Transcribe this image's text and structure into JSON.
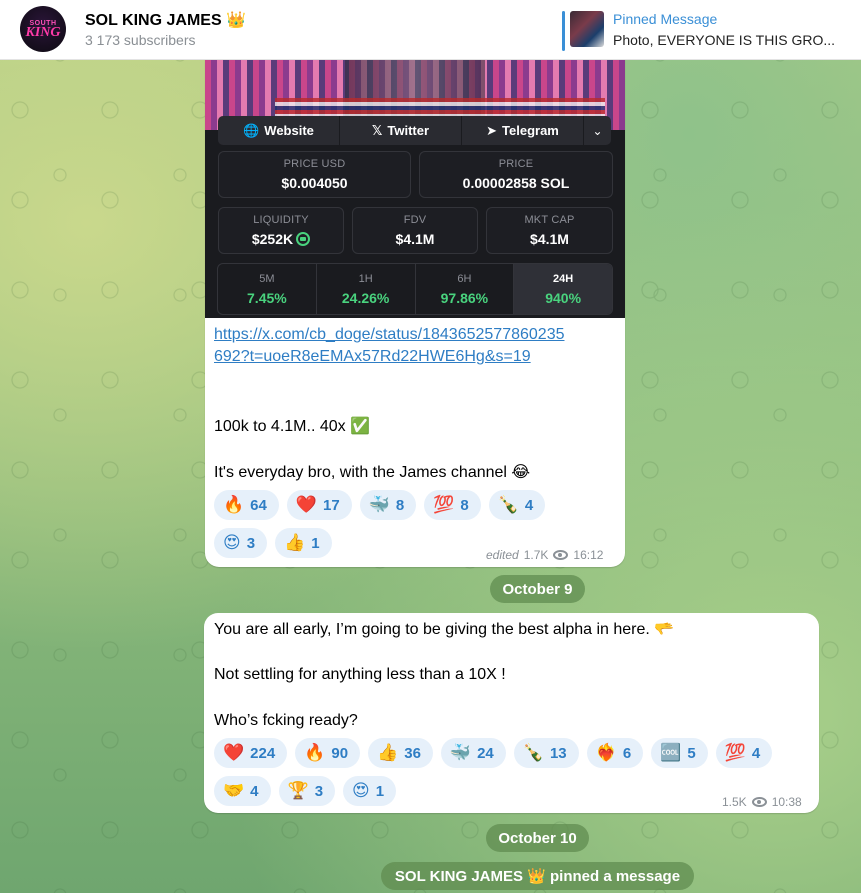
{
  "header": {
    "channel_title": "SOL KING JAMES 👑",
    "subscribers": "3 173 subscribers",
    "avatar_top": "SOUTH",
    "avatar_main": "KING",
    "pinned_title": "Pinned Message",
    "pinned_text": "Photo, EVERYONE IS THIS GRO..."
  },
  "message1": {
    "preview_links": {
      "website": "Website",
      "twitter": "Twitter",
      "telegram": "Telegram"
    },
    "stats": {
      "price_usd_label": "PRICE USD",
      "price_usd_value": "$0.004050",
      "price_label": "PRICE",
      "price_value": "0.00002858 SOL",
      "liquidity_label": "LIQUIDITY",
      "liquidity_value": "$252K",
      "fdv_label": "FDV",
      "fdv_value": "$4.1M",
      "mktcap_label": "MKT CAP",
      "mktcap_value": "$4.1M"
    },
    "timeframes": [
      {
        "label": "5M",
        "value": "7.45%"
      },
      {
        "label": "1H",
        "value": "24.26%"
      },
      {
        "label": "6H",
        "value": "97.86%"
      },
      {
        "label": "24H",
        "value": "940%"
      }
    ],
    "link_line1": "https://x.com/cb_doge/status/1843652577860235",
    "link_line2": "692?t=uoeR8eEMAx57Rd22HWE6Hg&s=19",
    "text_line1": "100k to 4.1M.. 40x ✅",
    "text_line2": "It's everyday bro, with the James channel 😂",
    "reactions": [
      {
        "emoji": "🔥",
        "count": "64"
      },
      {
        "emoji": "❤️",
        "count": "17"
      },
      {
        "emoji": "🐳",
        "count": "8"
      },
      {
        "emoji": "💯",
        "count": "8"
      },
      {
        "emoji": "🍾",
        "count": "4"
      },
      {
        "emoji": "😍",
        "count": "3"
      },
      {
        "emoji": "👍",
        "count": "1"
      }
    ],
    "edited": "edited",
    "views": "1.7K",
    "time": "16:12"
  },
  "date1": "October 9",
  "message2": {
    "line1": "You are all early, I’m going to be giving the best alpha in here. 🫳",
    "line2": "Not settling for anything less than a 10X !",
    "line3": "Who’s fcking ready?",
    "reactions": [
      {
        "emoji": "❤️",
        "count": "224"
      },
      {
        "emoji": "🔥",
        "count": "90"
      },
      {
        "emoji": "👍",
        "count": "36"
      },
      {
        "emoji": "🐳",
        "count": "24"
      },
      {
        "emoji": "🍾",
        "count": "13"
      },
      {
        "emoji": "❤️‍🔥",
        "count": "6"
      },
      {
        "emoji": "🆒",
        "count": "5"
      },
      {
        "emoji": "💯",
        "count": "4"
      },
      {
        "emoji": "🤝",
        "count": "4"
      },
      {
        "emoji": "🏆",
        "count": "3"
      },
      {
        "emoji": "😍",
        "count": "1"
      }
    ],
    "views": "1.5K",
    "time": "10:38"
  },
  "date2": "October 10",
  "service_message": "SOL KING JAMES 👑 pinned a message"
}
